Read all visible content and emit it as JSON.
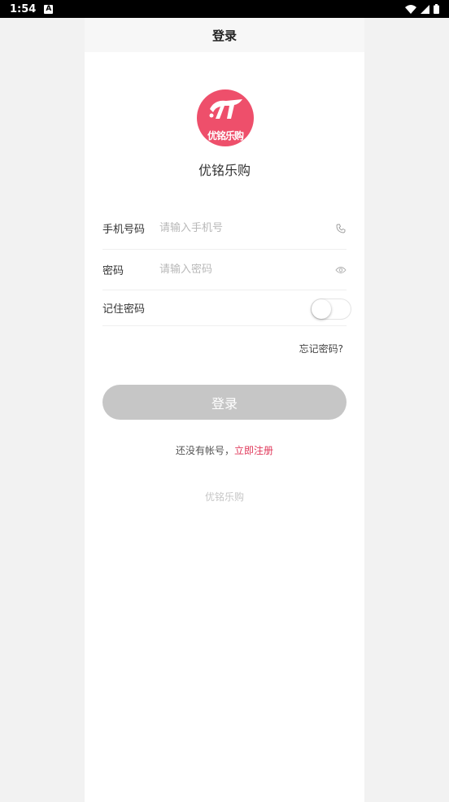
{
  "status_bar": {
    "time": "1:54",
    "notification_letter": "A"
  },
  "header": {
    "title": "登录"
  },
  "logo": {
    "text": "优铭乐购"
  },
  "app_name": "优铭乐购",
  "form": {
    "phone": {
      "label": "手机号码",
      "placeholder": "请输入手机号",
      "icon": "phone-icon"
    },
    "password": {
      "label": "密码",
      "placeholder": "请输入密码",
      "icon": "eye-icon"
    },
    "remember": {
      "label": "记住密码",
      "checked": false
    }
  },
  "forgot_link": "忘记密码?",
  "login_button": "登录",
  "register": {
    "prompt": "还没有帐号，",
    "link": "立即注册"
  },
  "footer": "优铭乐购",
  "colors": {
    "brand": "#ee4f6b",
    "link": "#e0385a",
    "button_disabled": "#c6c6c6"
  }
}
